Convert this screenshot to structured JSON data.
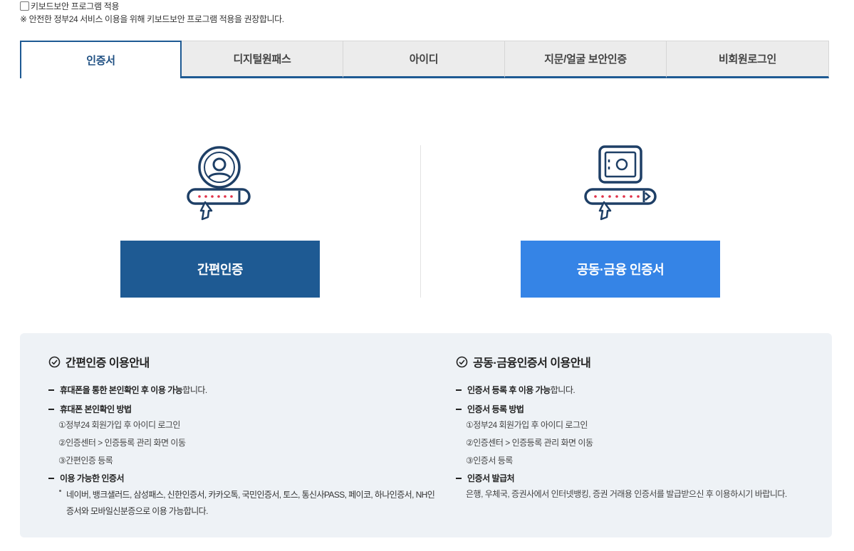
{
  "keyboard_security": {
    "checkbox_label": "키보드보안 프로그램 적용",
    "notice": "※ 안전한 정부24 서비스 이용을 위해 키보드보안 프로그램 적용을 권장합니다."
  },
  "tabs": [
    {
      "label": "인증서",
      "active": true
    },
    {
      "label": "디지털원패스",
      "active": false
    },
    {
      "label": "아이디",
      "active": false
    },
    {
      "label": "지문/얼굴 보안인증",
      "active": false
    },
    {
      "label": "비회원로그인",
      "active": false
    }
  ],
  "options": {
    "simple": {
      "icon": "user-password-icon",
      "button_label": "간편인증"
    },
    "joint": {
      "icon": "safe-password-icon",
      "button_label": "공동·금융 인증서"
    }
  },
  "guide": {
    "simple": {
      "title": "간편인증 이용안내",
      "line1_bold": "휴대폰을 통한 본인확인 후 이용 가능",
      "line1_rest": "합니다.",
      "line2_bold": "휴대폰 본인확인 방법",
      "steps": [
        "①정부24 회원가입 후 아이디 로그인",
        "②인증센터 > 인증등록 관리 화면 이동",
        "③간편인증 등록"
      ],
      "line3_bold": "이용 가능한 인증서",
      "bullet_line1": "네이버, 뱅크샐러드, 삼성패스, 신한인증서, 카카오톡, 국민인증서, 토스, 통신사PASS, 페이코, 하나인증서, NH인",
      "bullet_line2": "증서와 모바일신분증으로 이용 가능합니다."
    },
    "joint": {
      "title": "공동·금융인증서 이용안내",
      "line1_bold": "인증서 등록 후 이용 가능",
      "line1_rest": "합니다.",
      "line2_bold": "인증서 등록 방법",
      "steps": [
        "①정부24 회원가입 후 아이디 로그인",
        "②인증센터 > 인증등록 관리 화면 이동",
        "③인증서 등록"
      ],
      "line3_bold": "인증서 발급처",
      "issue_text": "은행, 우체국, 증권사에서 인터넷뱅킹, 증권 거래용 인증서를 발급받으신 후 이용하시기 바랍니다."
    }
  },
  "colors": {
    "primary_navy": "#1e5a93",
    "primary_blue": "#3584e6",
    "guide_bg": "#eef2f6",
    "password_dots": "#e03048"
  }
}
